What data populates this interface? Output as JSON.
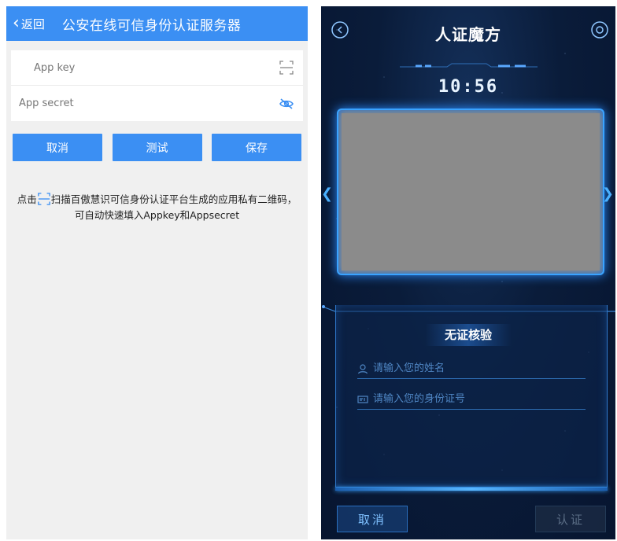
{
  "left_screen": {
    "header": {
      "back_label": "返回",
      "title": "公安在线可信身份认证服务器"
    },
    "form": {
      "app_key_placeholder": "App key",
      "app_secret_placeholder": "App secret"
    },
    "buttons": {
      "cancel": "取消",
      "test": "测试",
      "save": "保存"
    },
    "hint": {
      "prefix": "点击",
      "line1": "扫描百傲慧识可信身份认证平台生成的应用私有二维码，",
      "line2": "可自动快速填入Appkey和Appsecret"
    },
    "colors": {
      "primary": "#3b8ff3",
      "background": "#f0f0f0"
    }
  },
  "right_screen": {
    "title": "人证魔方",
    "clock": "10:56",
    "panel": {
      "title": "无证核验",
      "name_placeholder": "请输入您的姓名",
      "id_placeholder": "请输入您的身份证号"
    },
    "buttons": {
      "cancel": "取消",
      "authenticate": "认证"
    },
    "colors": {
      "accent": "#3aa3ff",
      "background": "#0a1c3a"
    }
  }
}
